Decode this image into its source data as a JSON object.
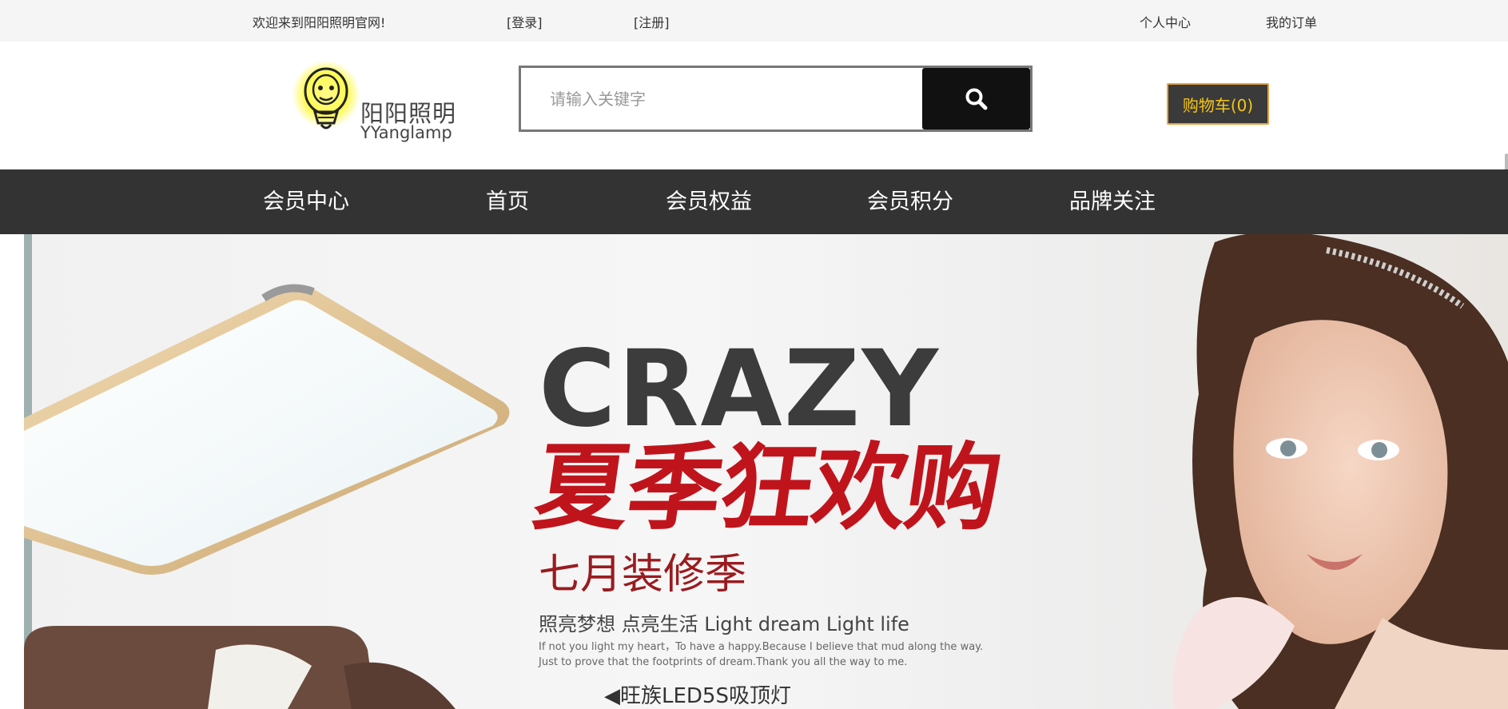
{
  "topbar": {
    "welcome": "欢迎来到阳阳照明官网!",
    "login": "[登录]",
    "register": "[注册]",
    "personal_center": "个人中心",
    "my_orders": "我的订单"
  },
  "header": {
    "logo": {
      "cn": "阳阳照明",
      "en": "YYanglamp",
      "icon": "bulb-face-icon"
    },
    "search": {
      "placeholder": "请输入关键字",
      "button_icon": "search-icon"
    },
    "cart_label": "购物车(0)"
  },
  "nav": {
    "items": [
      {
        "label": "会员中心"
      },
      {
        "label": "首页"
      },
      {
        "label": "会员权益"
      },
      {
        "label": "会员积分"
      },
      {
        "label": "品牌关注"
      }
    ]
  },
  "banner": {
    "headline": "CRAZY",
    "title": "夏季狂欢购",
    "subtitle": "七月装修季",
    "slogan": "照亮梦想 点亮生活  Light dream Light life",
    "line1": "If not you light my heart，To have a happy.Because I believe that mud along the way.",
    "line2": "Just to prove that the footprints of dream.Thank you all the way to me.",
    "product": "◀旺族LED5S吸顶灯"
  },
  "colors": {
    "topbar_bg": "#f5f5f5",
    "nav_bg": "#333333",
    "search_button_bg": "#111111",
    "cart_bg": "#3a3a3a",
    "cart_border": "#e6a23c",
    "cart_text": "#f5c518",
    "banner_title_red": "#c0141c"
  }
}
